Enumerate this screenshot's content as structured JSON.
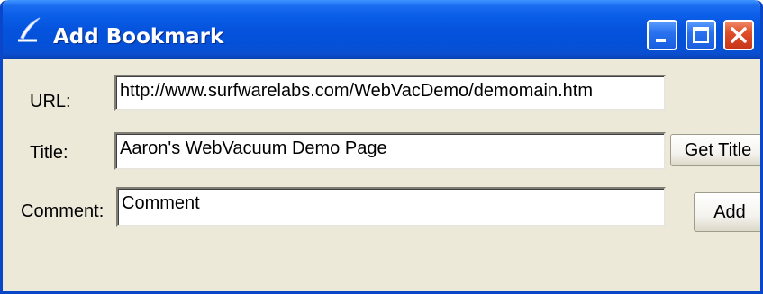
{
  "window": {
    "title": "Add Bookmark",
    "app_icon": "quill-icon",
    "controls": [
      "minimize-icon",
      "maximize-icon",
      "close-icon"
    ],
    "colors": {
      "titlebar": "#0553dd",
      "body": "#ece9d8",
      "close": "#e0502a"
    }
  },
  "form": {
    "url_label": "URL:",
    "url_value": "http://www.surfwarelabs.com/WebVacDemo/demomain.htm",
    "title_label": "Title:",
    "title_value": "Aaron's WebVacuum Demo Page",
    "comment_label": "Comment:",
    "comment_value": "Comment"
  },
  "buttons": {
    "get_title": "Get Title",
    "add": "Add"
  }
}
